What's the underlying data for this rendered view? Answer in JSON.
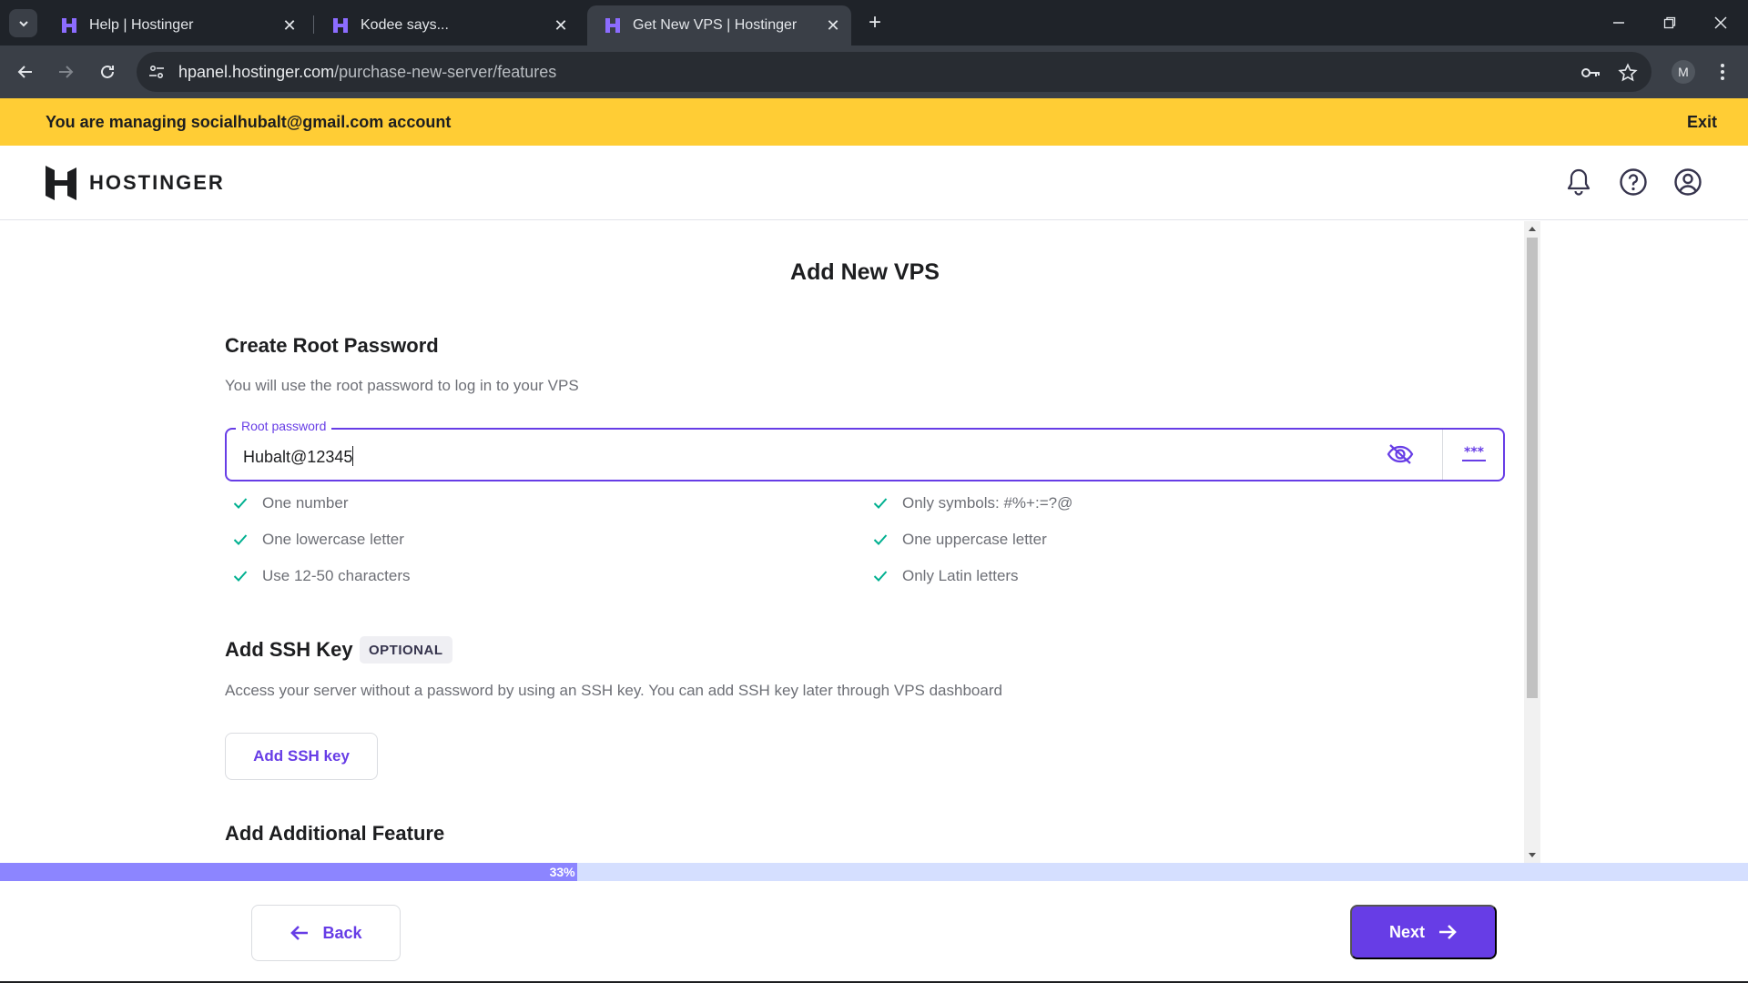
{
  "browser": {
    "tabs": [
      {
        "title": "Help | Hostinger",
        "active": false
      },
      {
        "title": "Kodee says...",
        "active": false
      },
      {
        "title": "Get New VPS | Hostinger",
        "active": true
      }
    ],
    "url_host": "hpanel.hostinger.com",
    "url_path": "/purchase-new-server/features",
    "profile_initial": "M"
  },
  "banner": {
    "text": "You are managing socialhubalt@gmail.com account",
    "exit_label": "Exit"
  },
  "header": {
    "logo_text": "HOSTINGER"
  },
  "page": {
    "title": "Add New VPS"
  },
  "root_password": {
    "heading": "Create Root Password",
    "description": "You will use the root password to log in to your VPS",
    "field_label": "Root password",
    "field_value": "Hubalt@12345",
    "requirements_left": [
      "One number",
      "One lowercase letter",
      "Use 12-50 characters"
    ],
    "requirements_right": [
      "Only symbols: #%+:=?@",
      "One uppercase letter",
      "Only Latin letters"
    ]
  },
  "ssh": {
    "heading": "Add SSH Key",
    "badge": "OPTIONAL",
    "description": "Access your server without a password by using an SSH key. You can add SSH key later through VPS dashboard",
    "button_label": "Add SSH key"
  },
  "additional": {
    "heading": "Add Additional Feature"
  },
  "progress": {
    "percent": 33,
    "label": "33%"
  },
  "footer": {
    "back_label": "Back",
    "next_label": "Next"
  },
  "colors": {
    "accent": "#673de6",
    "banner": "#ffcd35",
    "success": "#00b090"
  }
}
